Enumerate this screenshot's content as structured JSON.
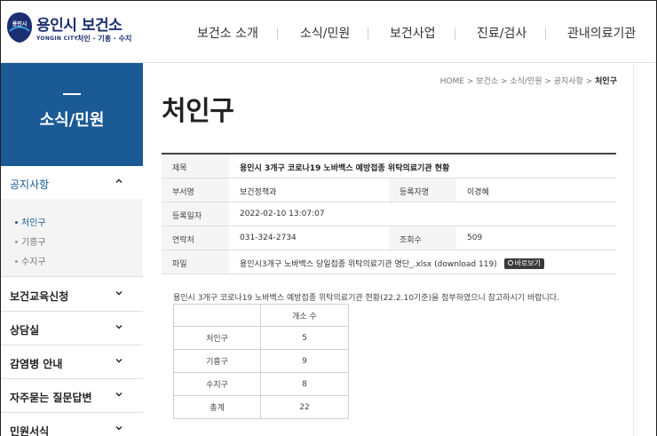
{
  "header": {
    "logo_main": "용인시 보건소",
    "logo_en": "YONGIN CITY",
    "logo_sub": "처인 · 기흥 · 수지",
    "emblem_text": "용인시",
    "nav": [
      "보건소 소개",
      "소식/민원",
      "보건사업",
      "진료/검사",
      "관내의료기관"
    ]
  },
  "sidebar": {
    "title": "소식/민원",
    "active": "공지사항",
    "submenu": [
      "처인구",
      "기흥구",
      "수지구"
    ],
    "items": [
      "보건교육신청",
      "상담실",
      "감염병 안내",
      "자주묻는 질문답변",
      "민원서식"
    ]
  },
  "breadcrumb": {
    "items": [
      "HOME",
      "보건소",
      "소식/민원",
      "공지사항"
    ],
    "current": "처인구"
  },
  "page_title": "처인구",
  "info": {
    "subject_label": "제목",
    "subject": "용인시 3개구 코로나19 노바백스 예방접종 위탁의료기관 현황",
    "dept_label": "부서명",
    "dept": "보건정책과",
    "author_label": "등록자명",
    "author": "이경혜",
    "date_label": "등록일자",
    "date": "2022-02-10 13:07:07",
    "contact_label": "연락처",
    "contact": "031-324-2734",
    "views_label": "조회수",
    "views": "509",
    "file_label": "파일",
    "file": "용인시3개구 노바백스 당일접종 위탁의료기관 명단_.xlsx (download 119)",
    "view_button": "바로보기"
  },
  "body_text": "용인시 3개구 코로나19 노바백스 예방접종 위탁의료기관 현황(22.2.10기준)을 첨부하였으니 참고하시기 바랍니다.",
  "table": {
    "header": [
      "",
      "개소 수"
    ],
    "rows": [
      [
        "처인구",
        "5"
      ],
      [
        "기흥구",
        "9"
      ],
      [
        "수지구",
        "8"
      ],
      [
        "총계",
        "22"
      ]
    ]
  },
  "colors": {
    "brand": "#1a5a95",
    "logo": "#1c2f73"
  }
}
